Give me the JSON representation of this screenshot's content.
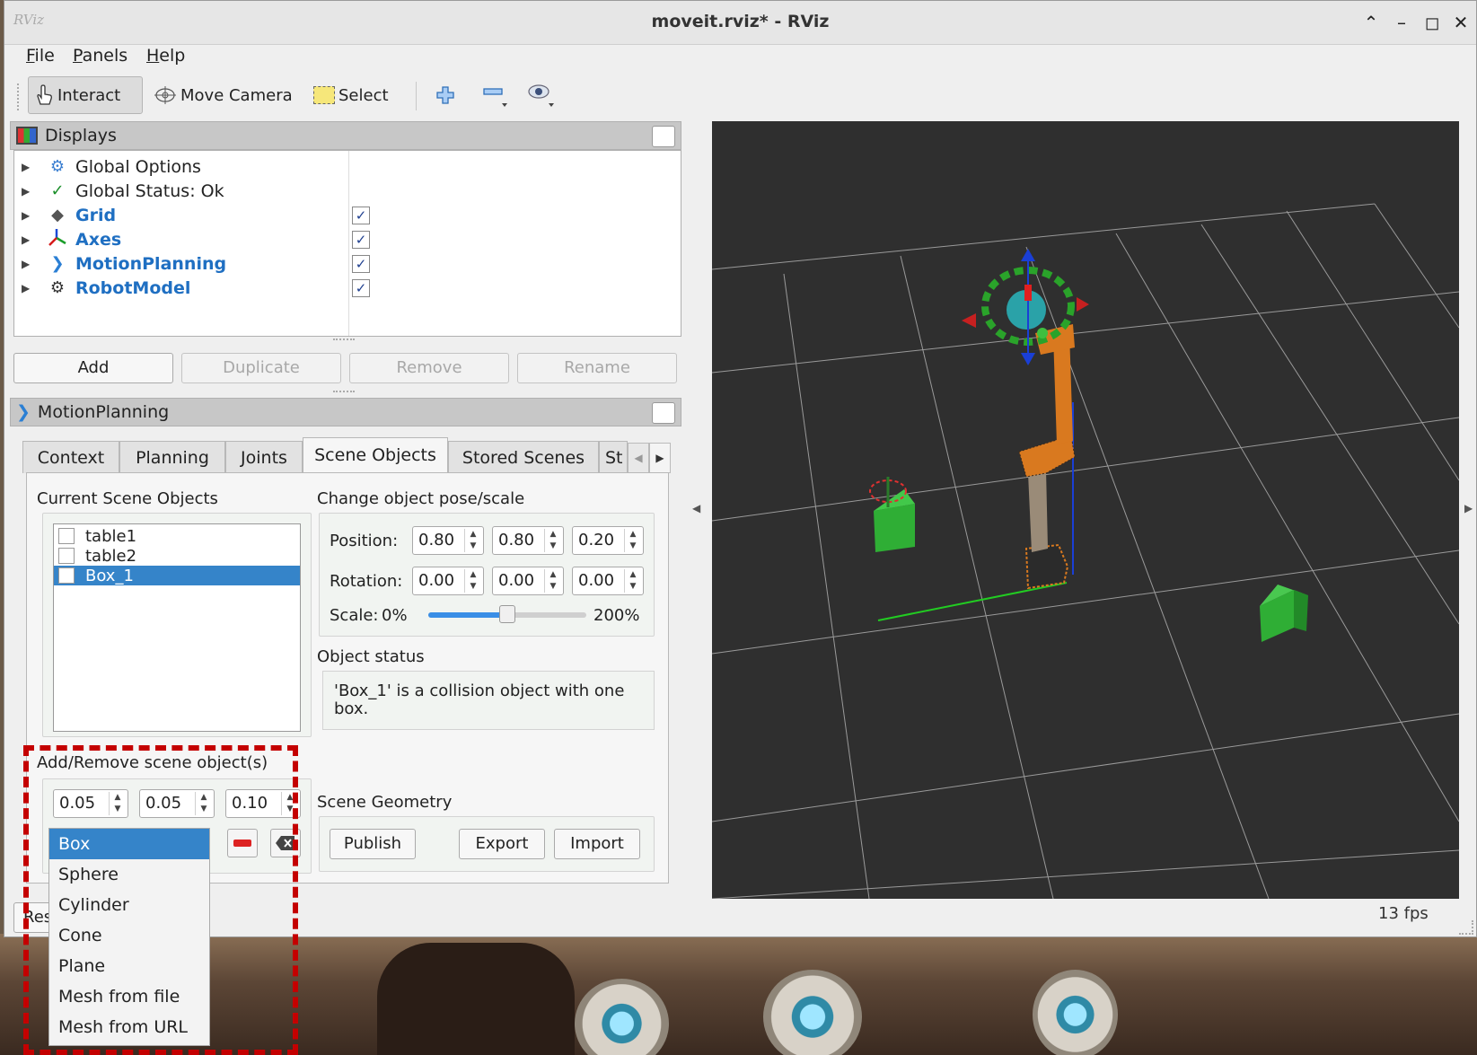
{
  "window": {
    "title": "moveit.rviz* - RViz",
    "app_icon_text": "RViz"
  },
  "menubar": {
    "file": "File",
    "panels": "Panels",
    "help": "Help"
  },
  "toolbar": {
    "interact": "Interact",
    "move_camera": "Move Camera",
    "select": "Select"
  },
  "displays": {
    "title": "Displays",
    "items": [
      {
        "label": "Global Options",
        "checked": null
      },
      {
        "label": "Global Status: Ok",
        "checked": null
      },
      {
        "label": "Grid",
        "checked": true
      },
      {
        "label": "Axes",
        "checked": true
      },
      {
        "label": "MotionPlanning",
        "checked": true
      },
      {
        "label": "RobotModel",
        "checked": true
      }
    ],
    "buttons": {
      "add": "Add",
      "duplicate": "Duplicate",
      "remove": "Remove",
      "rename": "Rename"
    }
  },
  "motion_planning": {
    "title": "MotionPlanning",
    "tabs": [
      "Context",
      "Planning",
      "Joints",
      "Scene Objects",
      "Stored Scenes",
      "St"
    ],
    "active_tab": "Scene Objects",
    "scene_objects": {
      "current_label": "Current Scene Objects",
      "objects": [
        "table1",
        "table2",
        "Box_1"
      ],
      "selected_object": "Box_1",
      "change_pose_label": "Change object pose/scale",
      "position_label": "Position:",
      "position": [
        "0.80",
        "0.80",
        "0.20"
      ],
      "rotation_label": "Rotation:",
      "rotation": [
        "0.00",
        "0.00",
        "0.00"
      ],
      "scale_label": "Scale:",
      "scale_min": "0%",
      "scale_max": "200%",
      "scale_value": 0.5,
      "object_status_label": "Object status",
      "object_status": "'Box_1' is a collision object with one box.",
      "add_remove_label": "Add/Remove scene object(s)",
      "dimensions": [
        "0.05",
        "0.05",
        "0.10"
      ],
      "shape_options": [
        "Box",
        "Sphere",
        "Cylinder",
        "Cone",
        "Plane",
        "Mesh from file",
        "Mesh from URL"
      ],
      "selected_shape": "Box",
      "scene_geometry_label": "Scene Geometry",
      "publish": "Publish",
      "export": "Export",
      "import": "Import"
    }
  },
  "bottom": {
    "reset_partial": "Res"
  },
  "viewport": {
    "fps": "13 fps",
    "background": "#2f2f2f",
    "grid_color": "#9a9a9a"
  },
  "colors": {
    "accent": "#3584c9",
    "link_blue": "#1f6fc2",
    "highlight": "#c40000",
    "scene_object_green": "#2fae35",
    "robot_orange": "#d9791f"
  }
}
